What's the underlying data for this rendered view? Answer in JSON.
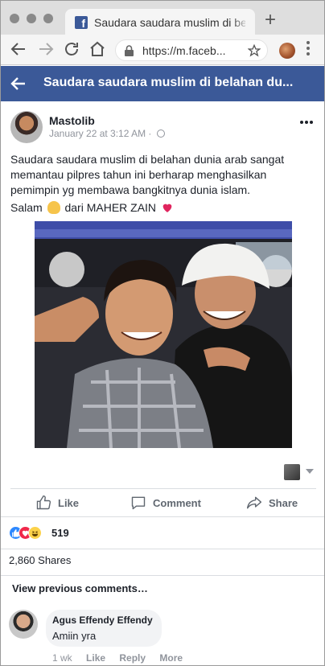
{
  "browser": {
    "tab_title": "Saudara saudara muslim di belahan dunia arab sangat memantau",
    "tab_favicon": "f",
    "new_tab_symbol": "+",
    "url": "https://m.faceb...",
    "accent": "#3b5998"
  },
  "header": {
    "title": "Saudara saudara muslim di belahan du..."
  },
  "post": {
    "author": "Mastolib",
    "timestamp": "January 22 at 3:12 AM",
    "separator": "·",
    "text": "Saudara saudara muslim di belahan dunia arab sangat memantau pilpres tahun ini berharap menghasilkan pemimpin yg membawa bangkitnya dunia islam.",
    "salam_prefix": "Salam",
    "salam_suffix": "dari MAHER ZAIN",
    "actions": {
      "like": "Like",
      "comment": "Comment",
      "share": "Share"
    },
    "reactions": {
      "count": "519",
      "icons": [
        "like-icon",
        "love-icon",
        "haha-icon"
      ]
    },
    "shares": "2,860 Shares"
  },
  "comments": {
    "view_previous": "View previous comments…",
    "items": [
      {
        "name": "Agus Effendy Effendy",
        "text": "Amiin yra",
        "time": "1 wk",
        "like": "Like",
        "reply": "Reply",
        "more": "More"
      }
    ]
  }
}
